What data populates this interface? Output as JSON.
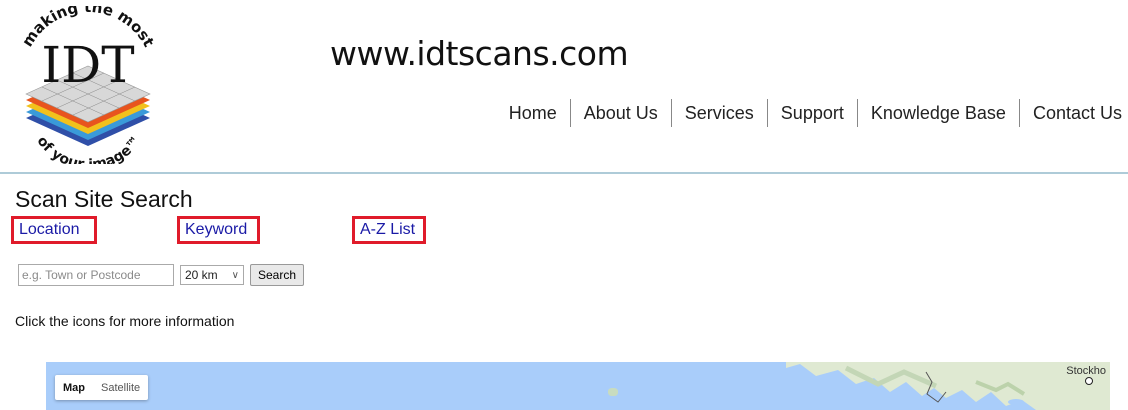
{
  "header": {
    "logo_text": "IDT",
    "logo_arc_top": "making the most",
    "logo_arc_bottom": "of your image™",
    "site_url": "www.idtscans.com"
  },
  "nav": {
    "items": [
      "Home",
      "About Us",
      "Services",
      "Support",
      "Knowledge Base",
      "Contact Us"
    ]
  },
  "page": {
    "title": "Scan Site Search",
    "tabs": {
      "location": "Location",
      "keyword": "Keyword",
      "az": "A-Z List"
    }
  },
  "search": {
    "placeholder": "e.g. Town or Postcode",
    "radius_value": "20 km",
    "button_label": "Search"
  },
  "hint": "Click the icons for more information",
  "map": {
    "map_label": "Map",
    "satellite_label": "Satellite",
    "city_label": "Stockho"
  },
  "colors": {
    "tab_border": "#e01b2a",
    "link": "#1a1aa6",
    "header_rule": "#aecbd8",
    "map_water": "#a9cdfa"
  }
}
